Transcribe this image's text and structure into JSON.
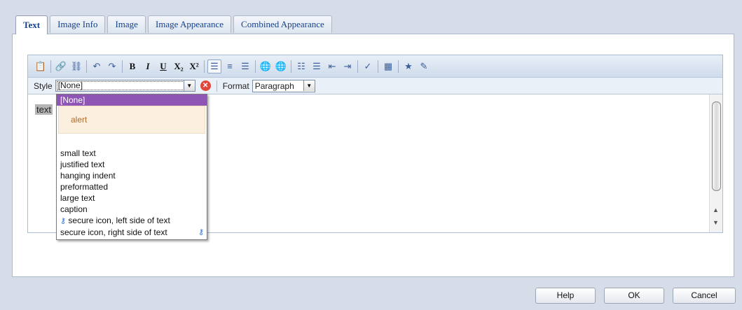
{
  "tabs": [
    "Text",
    "Image Info",
    "Image",
    "Image Appearance",
    "Combined Appearance"
  ],
  "toolbar": {
    "bold": "B",
    "italic": "I",
    "underline": "U",
    "subscript": "X₂",
    "superscript": "X²"
  },
  "stylebar": {
    "style_label": "Style",
    "style_value": "[None]",
    "format_label": "Format",
    "format_value": "Paragraph"
  },
  "content": {
    "sample_text": "text"
  },
  "dropdown": {
    "items": [
      "[None]",
      "alert",
      "small text",
      "justified text",
      "hanging indent",
      "preformatted",
      "large text",
      "caption",
      "secure icon, left side of text",
      "secure icon, right side of text"
    ]
  },
  "buttons": {
    "help": "Help",
    "ok": "OK",
    "cancel": "Cancel"
  },
  "colors": {
    "selected_item": "#8e55b4",
    "alert_bg": "#fbf0e0",
    "alert_text": "#b46a2a"
  }
}
